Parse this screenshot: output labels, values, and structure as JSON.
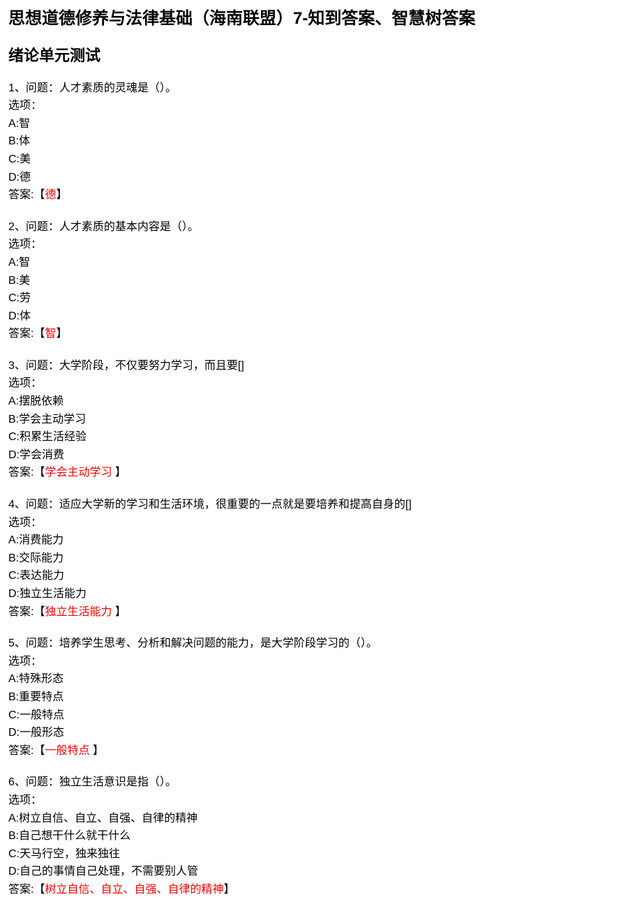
{
  "title": "思想道德修养与法律基础（海南联盟）7-知到答案、智慧树答案",
  "section": "绪论单元测试",
  "options_label": "选项：",
  "answer_label": "答案:",
  "bracket_open": "【",
  "bracket_close": "】",
  "questions": [
    {
      "num": "1、问题：人才素质的灵魂是（）。",
      "opts": [
        "A:智",
        "B:体",
        "C:美",
        "D:德"
      ],
      "answer": "德"
    },
    {
      "num": "2、问题：人才素质的基本内容是（）。",
      "opts": [
        "A:智",
        "B:美",
        "C:劳",
        "D:体"
      ],
      "answer": "智"
    },
    {
      "num": "3、问题：大学阶段，不仅要努力学习，而且要[]",
      "opts": [
        "A:摆脱依赖",
        "B:学会主动学习",
        "C:积累生活经验",
        "D:学会消费"
      ],
      "answer": "学会主动学习 "
    },
    {
      "num": "4、问题：适应大学新的学习和生活环境，很重要的一点就是要培养和提高自身的[]",
      "opts": [
        "A:消费能力",
        "B:交际能力",
        "C:表达能力",
        "D:独立生活能力"
      ],
      "answer": "独立生活能力 "
    },
    {
      "num": "5、问题：培养学生思考、分析和解决问题的能力，是大学阶段学习的（）。",
      "opts": [
        "A:特殊形态",
        "B:重要特点",
        "C:一般特点",
        "D:一般形态"
      ],
      "answer": "一般特点 "
    },
    {
      "num": "6、问题：独立生活意识是指（）。",
      "opts": [
        "A:树立自信、自立、自强、自律的精神",
        "B:自己想干什么就干什么",
        "C:天马行空，独来独往",
        "D:自己的事情自己处理，不需要别人管"
      ],
      "answer": "树立自信、自立、自强、自律的精神"
    }
  ]
}
